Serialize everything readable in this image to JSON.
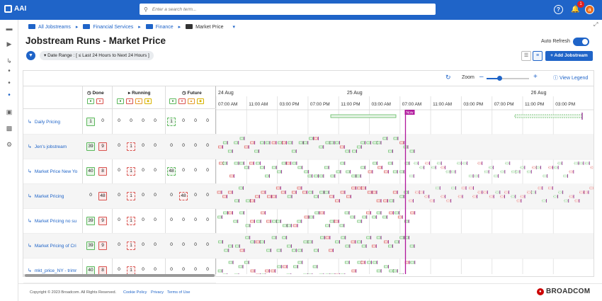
{
  "app": {
    "name": "AAI"
  },
  "search": {
    "placeholder": "Enter a search term..."
  },
  "header": {
    "notification_count": "1",
    "avatar_initial": "a",
    "help": "?"
  },
  "breadcrumb": {
    "items": [
      "All Jobstreams",
      "Financial Services",
      "Finance",
      "Market Price"
    ]
  },
  "page": {
    "title": "Jobstream Runs - Market Price",
    "filter_label": "Date Range : [ ≤ Last 24 Hours to Next 24 Hours ]",
    "auto_refresh_label": "Auto Refresh",
    "auto_refresh_on": true,
    "add_button": "Add Jobstream"
  },
  "timeline_tools": {
    "zoom_label": "Zoom",
    "zoom_level": 0.3,
    "legend_label": "View Legend",
    "minus": "–",
    "plus": "+"
  },
  "columns": {
    "done": "Done",
    "running": "Running",
    "future": "Future"
  },
  "timeline": {
    "dates": [
      {
        "label": "24 Aug"
      },
      {
        "label": "25 Aug"
      },
      {
        "label": "26 Aug"
      }
    ],
    "hours": [
      "07:00 AM",
      "11:00 AM",
      "03:00 PM",
      "07:00 PM",
      "11:00 PM",
      "03:00 AM",
      "07:00 AM",
      "11:00 AM",
      "03:00 PM",
      "07:00 PM",
      "11:00 PM",
      "03:00 PM"
    ],
    "now_label": "Now",
    "now_fraction": 0.5
  },
  "rows": [
    {
      "name": "Daily Pricing",
      "done_ok": "1",
      "done_err": "0",
      "run_ok": "0",
      "run_err": "0",
      "run_warn": "0",
      "run_hold": "0",
      "fut_ok": "1",
      "fut_err": "0",
      "fut_warn": "0",
      "fut_hold": "0"
    },
    {
      "name": "Jen's jobstream",
      "done_ok": "39",
      "done_err": "9",
      "run_ok": "0",
      "run_err": "1",
      "run_warn": "0",
      "run_hold": "0",
      "fut_ok": "0",
      "fut_err": "0",
      "fut_warn": "0",
      "fut_hold": "0"
    },
    {
      "name": "Market Price New Yo",
      "done_ok": "40",
      "done_err": "8",
      "run_ok": "0",
      "run_err": "1",
      "run_warn": "0",
      "run_hold": "0",
      "fut_ok": "48",
      "fut_err": "0",
      "fut_warn": "0",
      "fut_hold": "0"
    },
    {
      "name": "Market Pricing",
      "done_ok": "0",
      "done_err": "48",
      "run_ok": "0",
      "run_err": "1",
      "run_warn": "0",
      "run_hold": "0",
      "fut_ok": "0",
      "fut_err": "48",
      "fut_warn": "0",
      "fut_hold": "0"
    },
    {
      "name": "Market Pricing no su",
      "done_ok": "39",
      "done_err": "9",
      "run_ok": "0",
      "run_err": "1",
      "run_warn": "0",
      "run_hold": "0",
      "fut_ok": "0",
      "fut_err": "0",
      "fut_warn": "0",
      "fut_hold": "0"
    },
    {
      "name": "Market Pricing of Cri",
      "done_ok": "39",
      "done_err": "9",
      "run_ok": "0",
      "run_err": "1",
      "run_warn": "0",
      "run_hold": "0",
      "fut_ok": "0",
      "fut_err": "0",
      "fut_warn": "0",
      "fut_hold": "0"
    },
    {
      "name": "mkt_price_NY - trimr",
      "done_ok": "40",
      "done_err": "8",
      "run_ok": "0",
      "run_err": "1",
      "run_warn": "0",
      "run_hold": "0",
      "fut_ok": "0",
      "fut_err": "0",
      "fut_warn": "0",
      "fut_hold": "0"
    }
  ],
  "footer": {
    "copyright": "Copyright © 2023 Broadcom. All Rights Reserved.",
    "cookie": "Cookie Policy",
    "privacy": "Privacy",
    "terms": "Terms of Use",
    "brand": "BROADCOM"
  },
  "colors": {
    "primary": "#1f64c8",
    "ok": "#5cb85c",
    "error": "#d9534f",
    "now": "#b0179c"
  }
}
